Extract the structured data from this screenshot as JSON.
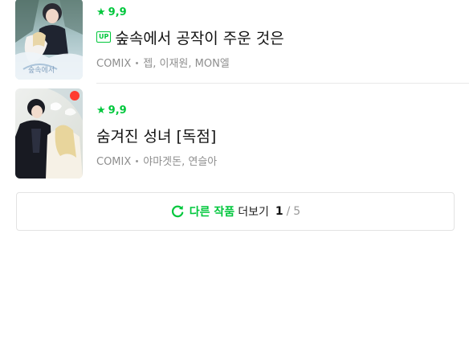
{
  "list": {
    "items": [
      {
        "rating": "9,9",
        "badge": "UP",
        "title": "숲속에서 공작이 주운 것은",
        "category": "COMIX",
        "authors": "젭, 이재원, MON엘"
      },
      {
        "rating": "9,9",
        "title": "숨겨진 성녀 [독점]",
        "category": "COMIX",
        "authors": "야마겟돈, 연슬아"
      }
    ]
  },
  "more": {
    "label_green": "다른 작품",
    "label_dark": "더보기",
    "current_page": "1",
    "separator": "/",
    "total_pages": "5"
  },
  "colors": {
    "accent": "#00c73c",
    "title_text": "#111111",
    "meta_text": "#8e8e8e",
    "border": "#e3e3e3"
  },
  "icons": {
    "star": "star-icon",
    "refresh": "refresh-icon",
    "up_badge": "up-badge"
  }
}
